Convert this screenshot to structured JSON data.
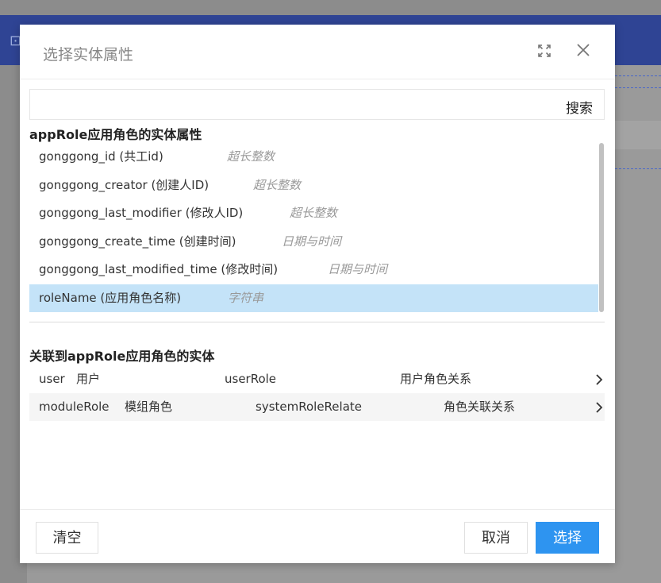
{
  "dialog": {
    "title": "选择实体属性",
    "search_button": "搜索",
    "attributes_section_title": "appRole应用角色的实体属性",
    "attributes": [
      {
        "name": "gonggong_id (共工id)",
        "type": "超长整数",
        "selected": false
      },
      {
        "name": "gonggong_creator (创建人ID)",
        "type": "超长整数",
        "selected": false
      },
      {
        "name": "gonggong_last_modifier (修改人ID)",
        "type": "超长整数",
        "selected": false
      },
      {
        "name": "gonggong_create_time (创建时间)",
        "type": "日期与时间",
        "selected": false
      },
      {
        "name": "gonggong_last_modified_time (修改时间)",
        "type": "日期与时间",
        "selected": false
      },
      {
        "name": "roleName (应用角色名称)",
        "type": "字符串",
        "selected": true
      }
    ],
    "relations_section_title": "关联到appRole应用角色的实体",
    "relations": [
      {
        "entity": "user",
        "entity_label": "用户",
        "relation": "userRole",
        "relation_label": "用户角色关系"
      },
      {
        "entity": "moduleRole",
        "entity_label": "模组角色",
        "relation": "systemRoleRelate",
        "relation_label": "角色关联关系"
      }
    ],
    "footer": {
      "clear_label": "清空",
      "cancel_label": "取消",
      "ok_label": "选择"
    }
  },
  "colors": {
    "primary": "#2e94f0",
    "selected_row": "#c4e3f8",
    "header_bar": "#2f4494",
    "overlay": "#8c8c8c"
  }
}
